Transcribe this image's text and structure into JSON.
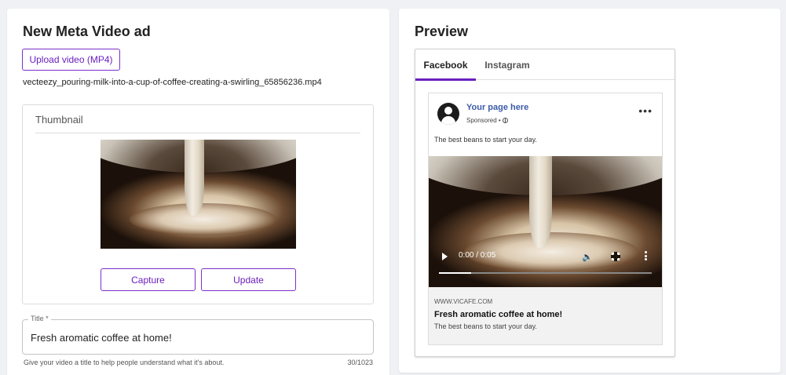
{
  "editor": {
    "title": "New Meta Video ad",
    "upload_label": "Upload video (MP4)",
    "filename": "vecteezy_pouring-milk-into-a-cup-of-coffee-creating-a-swirling_65856236.mp4",
    "thumbnail": {
      "label": "Thumbnail",
      "capture_label": "Capture",
      "update_label": "Update"
    },
    "title_field": {
      "legend": "Title *",
      "value": "Fresh aromatic coffee at home!",
      "helper": "Give your video a title to help people understand what it's about.",
      "counter": "30/1023"
    }
  },
  "preview": {
    "title": "Preview",
    "tabs": [
      {
        "label": "Facebook",
        "active": true
      },
      {
        "label": "Instagram",
        "active": false
      }
    ],
    "post": {
      "page_name": "Your page here",
      "sponsored": "Sponsored •",
      "text": "The best beans to start your day.",
      "video_time": "0:00 / 0:05",
      "video_progress": 0.15,
      "link_domain": "WWW.VICAFE.COM",
      "link_headline": "Fresh aromatic coffee at home!",
      "link_description": "The best beans to start your day."
    }
  },
  "colors": {
    "accent": "#6a1fbf",
    "page_link": "#3b5ca8",
    "background": "#f0f1f4"
  }
}
